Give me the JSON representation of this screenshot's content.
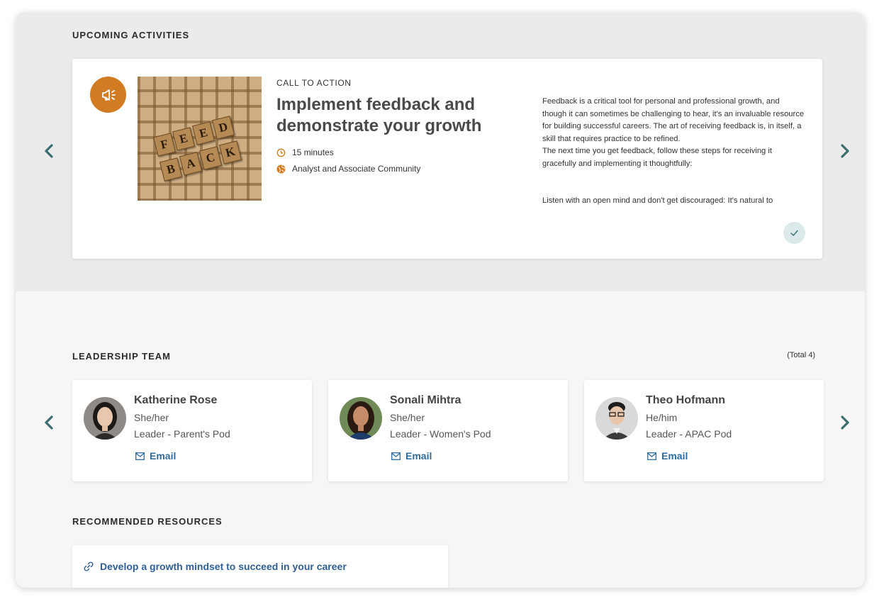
{
  "upcoming": {
    "title": "UPCOMING ACTIVITIES",
    "activity": {
      "label": "CALL TO ACTION",
      "title": "Implement feedback and demonstrate your growth",
      "duration": "15 minutes",
      "community": "Analyst and Associate Community",
      "icon": "megaphone-icon",
      "image_tiles": [
        "F",
        "E",
        "E",
        "D",
        "B",
        "A",
        "C",
        "K"
      ],
      "description_p1": "Feedback is a critical tool for personal and professional growth, and though it can sometimes be challenging to hear, it's an invaluable resource for building successful careers. The art of receiving feedback is, in itself, a skill that requires practice to be refined.",
      "description_p2": "The next time you get feedback, follow these steps for receiving it gracefully and implementing it thoughtfully:",
      "description_p3": "Listen with an open mind and don't get discouraged: It's natural to"
    }
  },
  "leadership": {
    "title": "LEADERSHIP TEAM",
    "total": "(Total 4)",
    "email_label": "Email",
    "leaders": [
      {
        "name": "Katherine Rose",
        "pronouns": "She/her",
        "role": "Leader - Parent's Pod"
      },
      {
        "name": "Sonali Mihtra",
        "pronouns": "She/her",
        "role": "Leader - Women's Pod"
      },
      {
        "name": "Theo Hofmann",
        "pronouns": "He/him",
        "role": "Leader - APAC Pod"
      }
    ]
  },
  "resources": {
    "title": "RECOMMENDED RESOURCES",
    "items": [
      {
        "label": "Develop a growth mindset to succeed in your career"
      }
    ]
  },
  "colors": {
    "accent_orange": "#d17c22",
    "teal_arrow": "#3c6e6f",
    "link_blue": "#2f6c9f"
  }
}
